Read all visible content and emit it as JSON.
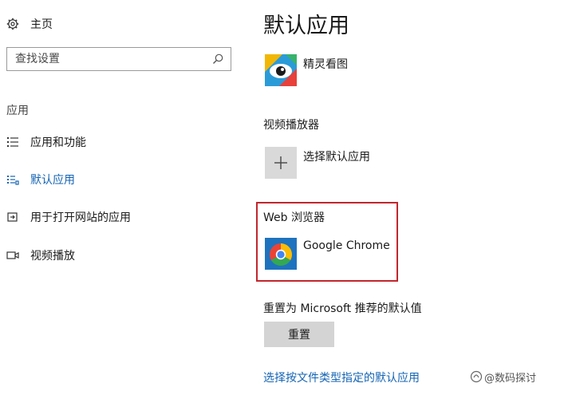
{
  "sidebar": {
    "home_label": "主页",
    "search": {
      "placeholder": "查找设置",
      "value": ""
    },
    "section_header": "应用",
    "items": [
      {
        "label": "应用和功能",
        "icon": "list-icon",
        "active": false
      },
      {
        "label": "默认应用",
        "icon": "default-apps-icon",
        "active": true
      },
      {
        "label": "用于打开网站的应用",
        "icon": "open-website-icon",
        "active": false
      },
      {
        "label": "视频播放",
        "icon": "video-icon",
        "active": false
      }
    ]
  },
  "main": {
    "title": "默认应用",
    "photo_viewer": {
      "app_name": "精灵看图",
      "icon": "photo-viewer-icon"
    },
    "video_player": {
      "label": "视频播放器",
      "app_name": "选择默认应用",
      "icon": "plus-icon"
    },
    "web_browser": {
      "label": "Web 浏览器",
      "app_name": "Google Chrome",
      "icon": "chrome-icon"
    },
    "reset": {
      "label": "重置为 Microsoft 推荐的默认值",
      "button_label": "重置"
    },
    "link_by_file_type": "选择按文件类型指定的默认应用"
  },
  "watermark": {
    "text": "@数码探讨"
  },
  "colors": {
    "accent": "#1464b4",
    "highlight_border": "#c1272d",
    "button_bg": "#d4d4d4",
    "plus_bg": "#d9d9d9"
  }
}
